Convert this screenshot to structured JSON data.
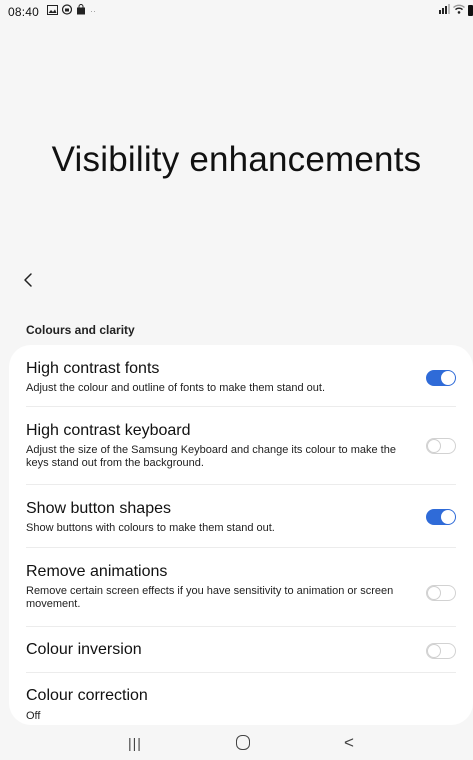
{
  "status_bar": {
    "time": "08:40",
    "notification_icons": [
      "gallery-icon",
      "security-icon",
      "store-icon",
      "more-dots-icon"
    ],
    "right_icons": [
      "signal-icon",
      "wifi-icon",
      "battery-icon"
    ]
  },
  "page": {
    "title": "Visibility enhancements"
  },
  "section": {
    "header": "Colours and clarity"
  },
  "settings": [
    {
      "title": "High contrast fonts",
      "description": "Adjust the colour and outline of fonts to make them stand out.",
      "enabled": true
    },
    {
      "title": "High contrast keyboard",
      "description": "Adjust the size of the Samsung Keyboard and change its colour to make the keys stand out from the background.",
      "enabled": false
    },
    {
      "title": "Show button shapes",
      "description": "Show buttons with colours to make them stand out.",
      "enabled": true
    },
    {
      "title": "Remove animations",
      "description": "Remove certain screen effects if you have sensitivity to animation or screen movement.",
      "enabled": false
    },
    {
      "title": "Colour inversion",
      "description": "",
      "enabled": false
    },
    {
      "title": "Colour correction",
      "description": "Off"
    }
  ],
  "nav_bar": {
    "recents_glyph": "|||",
    "back_glyph": "<"
  },
  "colors": {
    "accent": "#2f6bd8",
    "background": "#f6f6f6",
    "card": "#ffffff"
  }
}
